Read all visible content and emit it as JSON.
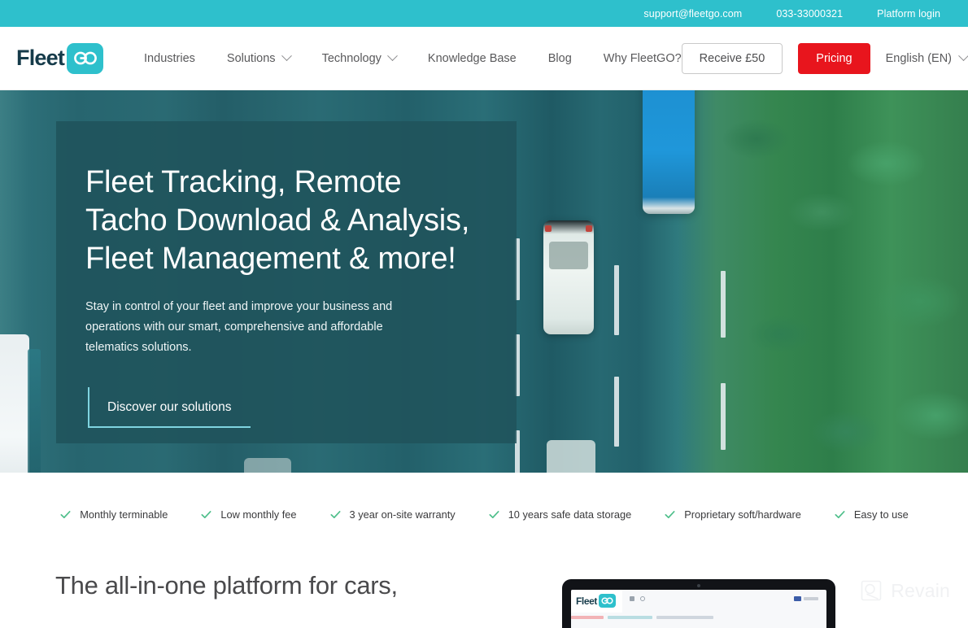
{
  "topbar": {
    "links": [
      {
        "label": "support@fleetgo.com",
        "name": "support-email-link"
      },
      {
        "label": "033-33000321",
        "name": "phone-link"
      },
      {
        "label": "Platform login",
        "name": "platform-login-link"
      }
    ],
    "bg_color": "#2ec0cc"
  },
  "nav": {
    "logo": {
      "word": "Fleet",
      "badge": "GO",
      "badge_color": "#2ec0cc",
      "word_color": "#163b4a"
    },
    "items": [
      {
        "label": "Industries",
        "has_caret": false
      },
      {
        "label": "Solutions",
        "has_caret": true
      },
      {
        "label": "Technology",
        "has_caret": true
      },
      {
        "label": "Knowledge Base",
        "has_caret": false
      },
      {
        "label": "Blog",
        "has_caret": false
      },
      {
        "label": "Why FleetGO?",
        "has_caret": false
      }
    ],
    "receive_button": "Receive £50",
    "pricing_button": "Pricing",
    "pricing_color": "#e8151d",
    "language": "English (EN)"
  },
  "hero": {
    "heading": "Fleet Tracking, Remote\nTacho Download & Analysis,\nFleet Management & more!",
    "subheading": "Stay in control of your fleet and improve your business and\noperations with our smart, comprehensive and affordable\ntelematics solutions.",
    "cta": "Discover our solutions",
    "overlay_color": "#1f535b",
    "cta_border_color": "#7fd4e0"
  },
  "usp": {
    "check_color": "#4fbf8b",
    "items": [
      "Monthly terminable",
      "Low monthly fee",
      "3 year on-site warranty",
      "10 years safe data storage",
      "Proprietary soft/hardware",
      "Easy to use"
    ]
  },
  "lower": {
    "heading": "The all-in-one platform for cars,",
    "tablet_logo_word": "Fleet",
    "tablet_logo_badge": "GO"
  },
  "watermark": {
    "label": "Revain"
  }
}
